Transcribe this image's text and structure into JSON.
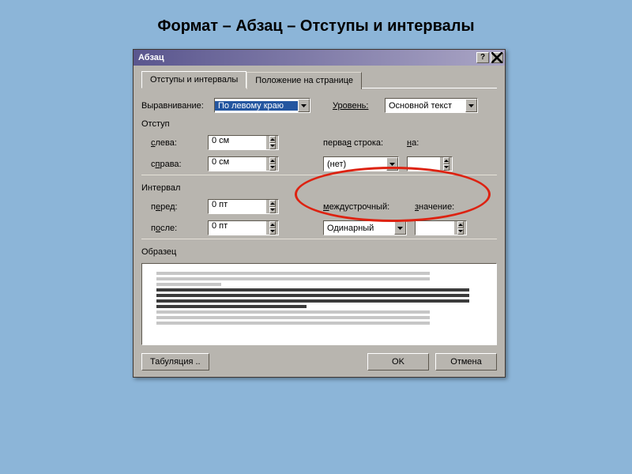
{
  "heading": "Формат – Абзац – Отступы и интервалы",
  "window": {
    "title": "Абзац"
  },
  "tabs": {
    "active": "Отступы и интервалы",
    "other": "Положение на странице"
  },
  "align": {
    "label": "Выравнивание:",
    "value": "По левому краю",
    "level_label": "Уровень:",
    "level_value": "Основной текст"
  },
  "indent": {
    "title": "Отступ",
    "left_label": "слева:",
    "left_value": "0 см",
    "right_label": "справа:",
    "right_value": "0 см",
    "firstline_label": "первая строка:",
    "firstline_value": "(нет)",
    "by_label": "на:",
    "by_value": ""
  },
  "spacing": {
    "title": "Интервал",
    "before_label": "перед:",
    "before_value": "0 пт",
    "after_label": "после:",
    "after_value": "0 пт",
    "line_label": "междустрочный:",
    "line_value": "Одинарный",
    "at_label": "значение:",
    "at_value": ""
  },
  "sample": {
    "title": "Образец"
  },
  "buttons": {
    "tabs": "Табуляция ..",
    "ok": "OK",
    "cancel": "Отмена"
  }
}
